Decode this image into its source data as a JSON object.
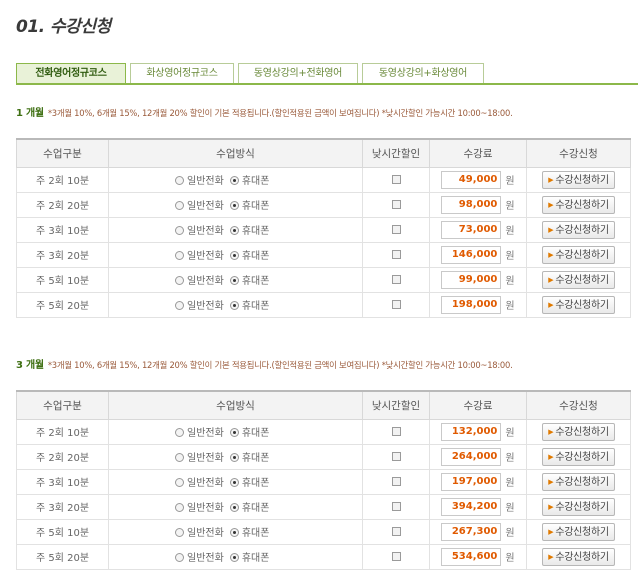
{
  "page_title": "01. 수강신청",
  "tabs": [
    {
      "label": "전화영어정규코스",
      "active": true
    },
    {
      "label": "화상영어정규코스",
      "active": false
    },
    {
      "label": "동영상강의+전화영어",
      "active": false
    },
    {
      "label": "동영상강의+화상영어",
      "active": false
    }
  ],
  "columns": [
    "수업구분",
    "수업방식",
    "낮시간할인",
    "수강료",
    "수강신청"
  ],
  "method_options": [
    "일반전화",
    "휴대폰"
  ],
  "currency_unit": "원",
  "apply_label": "수강신청하기",
  "plans": [
    {
      "months_label": "1 개월",
      "note": "*3개월 10%, 6개월 15%, 12개월 20% 할인이 기본 적용됩니다.(할인적용된 금액이 보여집니다) *낮시간할인 가능시간 10:00~18:00.",
      "rows": [
        {
          "type": "주 2회 10분",
          "price": "49,000"
        },
        {
          "type": "주 2회 20분",
          "price": "98,000"
        },
        {
          "type": "주 3회 10분",
          "price": "73,000"
        },
        {
          "type": "주 3회 20분",
          "price": "146,000"
        },
        {
          "type": "주 5회 10분",
          "price": "99,000"
        },
        {
          "type": "주 5회 20분",
          "price": "198,000"
        }
      ]
    },
    {
      "months_label": "3 개월",
      "note": "*3개월 10%, 6개월 15%, 12개월 20% 할인이 기본 적용됩니다.(할인적용된 금액이 보여집니다) *낮시간할인 가능시간 10:00~18:00.",
      "rows": [
        {
          "type": "주 2회 10분",
          "price": "132,000"
        },
        {
          "type": "주 2회 20분",
          "price": "264,000"
        },
        {
          "type": "주 3회 10분",
          "price": "197,000"
        },
        {
          "type": "주 3회 20분",
          "price": "394,200"
        },
        {
          "type": "주 5회 10분",
          "price": "267,300"
        },
        {
          "type": "주 5회 20분",
          "price": "534,600"
        }
      ]
    }
  ]
}
